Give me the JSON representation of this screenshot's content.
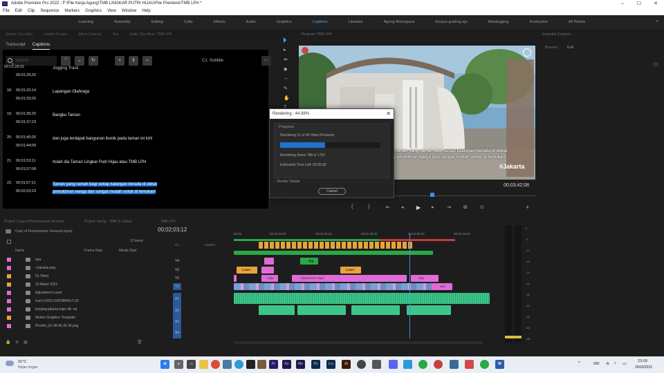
{
  "window": {
    "title": "Adobe Premiere Pro 2022 - F:\\File Kerja Agung\\TMB LINGKAR PUTRI HIJAU\\File Premiere\\TMB LPH *"
  },
  "menu": [
    "File",
    "Edit",
    "Clip",
    "Sequence",
    "Markers",
    "Graphics",
    "View",
    "Window",
    "Help"
  ],
  "workspaces": [
    "Learning",
    "Assembly",
    "Editing",
    "Color",
    "Effects",
    "Audio",
    "Graphics",
    "Captions",
    "Libraries",
    "Agung Workspace",
    "khusus grading aja",
    "Metalogging",
    "Production",
    "All Panels"
  ],
  "active_workspace": "Captions",
  "source_tabs": [
    "Source: (no clips)",
    "Lumetri Scopes",
    "Effect Controls",
    "Text",
    "Audio Clip Mixer: TMB LPH"
  ],
  "captions": {
    "tabs": [
      "Transcript",
      "Captions"
    ],
    "active_tab": "Captions",
    "search_placeholder": "Search",
    "track_label": "C1: Subtitle",
    "partial_text": "Jogging Track",
    "rows": [
      {
        "num": "18.",
        "start": "00;01;32;14",
        "end": "00;01;33;25",
        "text1": "Lapangan Olahraga",
        "text2": ""
      },
      {
        "num": "19.",
        "start": "00;01;36;20",
        "end": "00;01;37;23",
        "text1": "Bangku Taman",
        "text2": ""
      },
      {
        "num": "20.",
        "start": "00;01;40;26",
        "end": "00;01;44;09",
        "text1": "dan juga terdapat bangunan ikonik pada taman ini loh!",
        "text2": ""
      },
      {
        "num": "21.",
        "start": "00;01;53;11",
        "end": "00;01;57;08",
        "text1": "Itulah dia Taman Lingkar Putri Hijau atau TMB LPH",
        "text2": ""
      },
      {
        "num": "22.",
        "start": "00;01;57;11",
        "end": "00;02;03;23",
        "text1": "Taman yang ramah bagi setiap kalangan berada di dekat",
        "text2": "pemukiman warga dan sangat mudah untuk di temukan!"
      }
    ]
  },
  "program": {
    "header": "Program: TMB LPH",
    "timecode": "00;03;42;08",
    "subtitle_line1": "Taman yang ramah bagi setiap kalangan berada di dekat",
    "subtitle_line2": "pemukiman warga dan sangat mudah untuk di temukan!",
    "watermark": "#Jakarta"
  },
  "essential_graphics": {
    "title": "Essential Graphics",
    "tabs": [
      "Browse",
      "Edit"
    ]
  },
  "render": {
    "title": "Rendering : 44.98%",
    "progress_label": "Progress",
    "status": "Rendering 21 of 46 Video Previews",
    "progress": 0.45,
    "frame": "Rendering frame 788 of 1752",
    "time_left": "Estimated Time Left: 00:00:39",
    "details": "Render Details",
    "cancel": "Cancel"
  },
  "project": {
    "tabs": [
      "Project: Copy of Pemulasaran Jenazah",
      "Project: lacing - TMB Dr Jaksel"
    ],
    "name": "Copy of Pemulasaran Jenazah.prproj",
    "count": "22 items",
    "columns": [
      "Name",
      "Frame Rate",
      "Media Start"
    ],
    "items": [
      {
        "name": "aaa",
        "color": "#e06bd6"
      },
      {
        "name": "+Jakarta.png",
        "color": "#e06bd6"
      },
      {
        "name": "01 Tebet",
        "color": "#e8a33a"
      },
      {
        "name": "10 Maret 2022",
        "color": "#e8a33a"
      },
      {
        "name": "Adjustment Layer",
        "color": "#e06bd6"
      },
      {
        "name": "icon-LOGO-DISTAMHUT-20",
        "color": "#e06bd6"
      },
      {
        "name": "kissjing-jakarta-logo-o8--nd",
        "color": "#e06bd6"
      },
      {
        "name": "Motion Graphics Template",
        "color": "#e8a33a"
      },
      {
        "name": "PicsArt_01-08-06.35.34.png",
        "color": "#e06bd6"
      }
    ]
  },
  "timeline": {
    "tab": "TMB LPH",
    "timecode": "00;02;03;12",
    "ruler": [
      "00;00",
      "00;00;32;00",
      "00;01;04;02",
      "00;01;36;02",
      "00;02;08;04",
      "00;02;40;04"
    ],
    "subtitle_track": "Subtitle",
    "video_tracks": [
      "V4",
      "V3",
      "V2",
      "V1"
    ],
    "audio_tracks": [
      "A1",
      "A2",
      "A3",
      "A4"
    ],
    "clip_labels": {
      "lower1": "Lower",
      "lower2": "Lower",
      "jpg": "Jpg",
      "adju1": "Adju",
      "adjustment": "Adjustment Layer",
      "adju2": "Adju",
      "aaa": "aaa"
    }
  },
  "meters": {
    "scale": [
      "0",
      "-6",
      "-12",
      "-18",
      "-24",
      "-30",
      "-36",
      "-42",
      "-48",
      "-54",
      "-dB"
    ]
  },
  "taskbar": {
    "temp": "31°C",
    "weather": "Hujan ringan",
    "lang": "IND",
    "time": "23:09",
    "date": "29/03/2022",
    "apps": [
      "Pr",
      "Ae",
      "Me",
      "Ps",
      "Lrc",
      "Ai",
      "W"
    ]
  }
}
